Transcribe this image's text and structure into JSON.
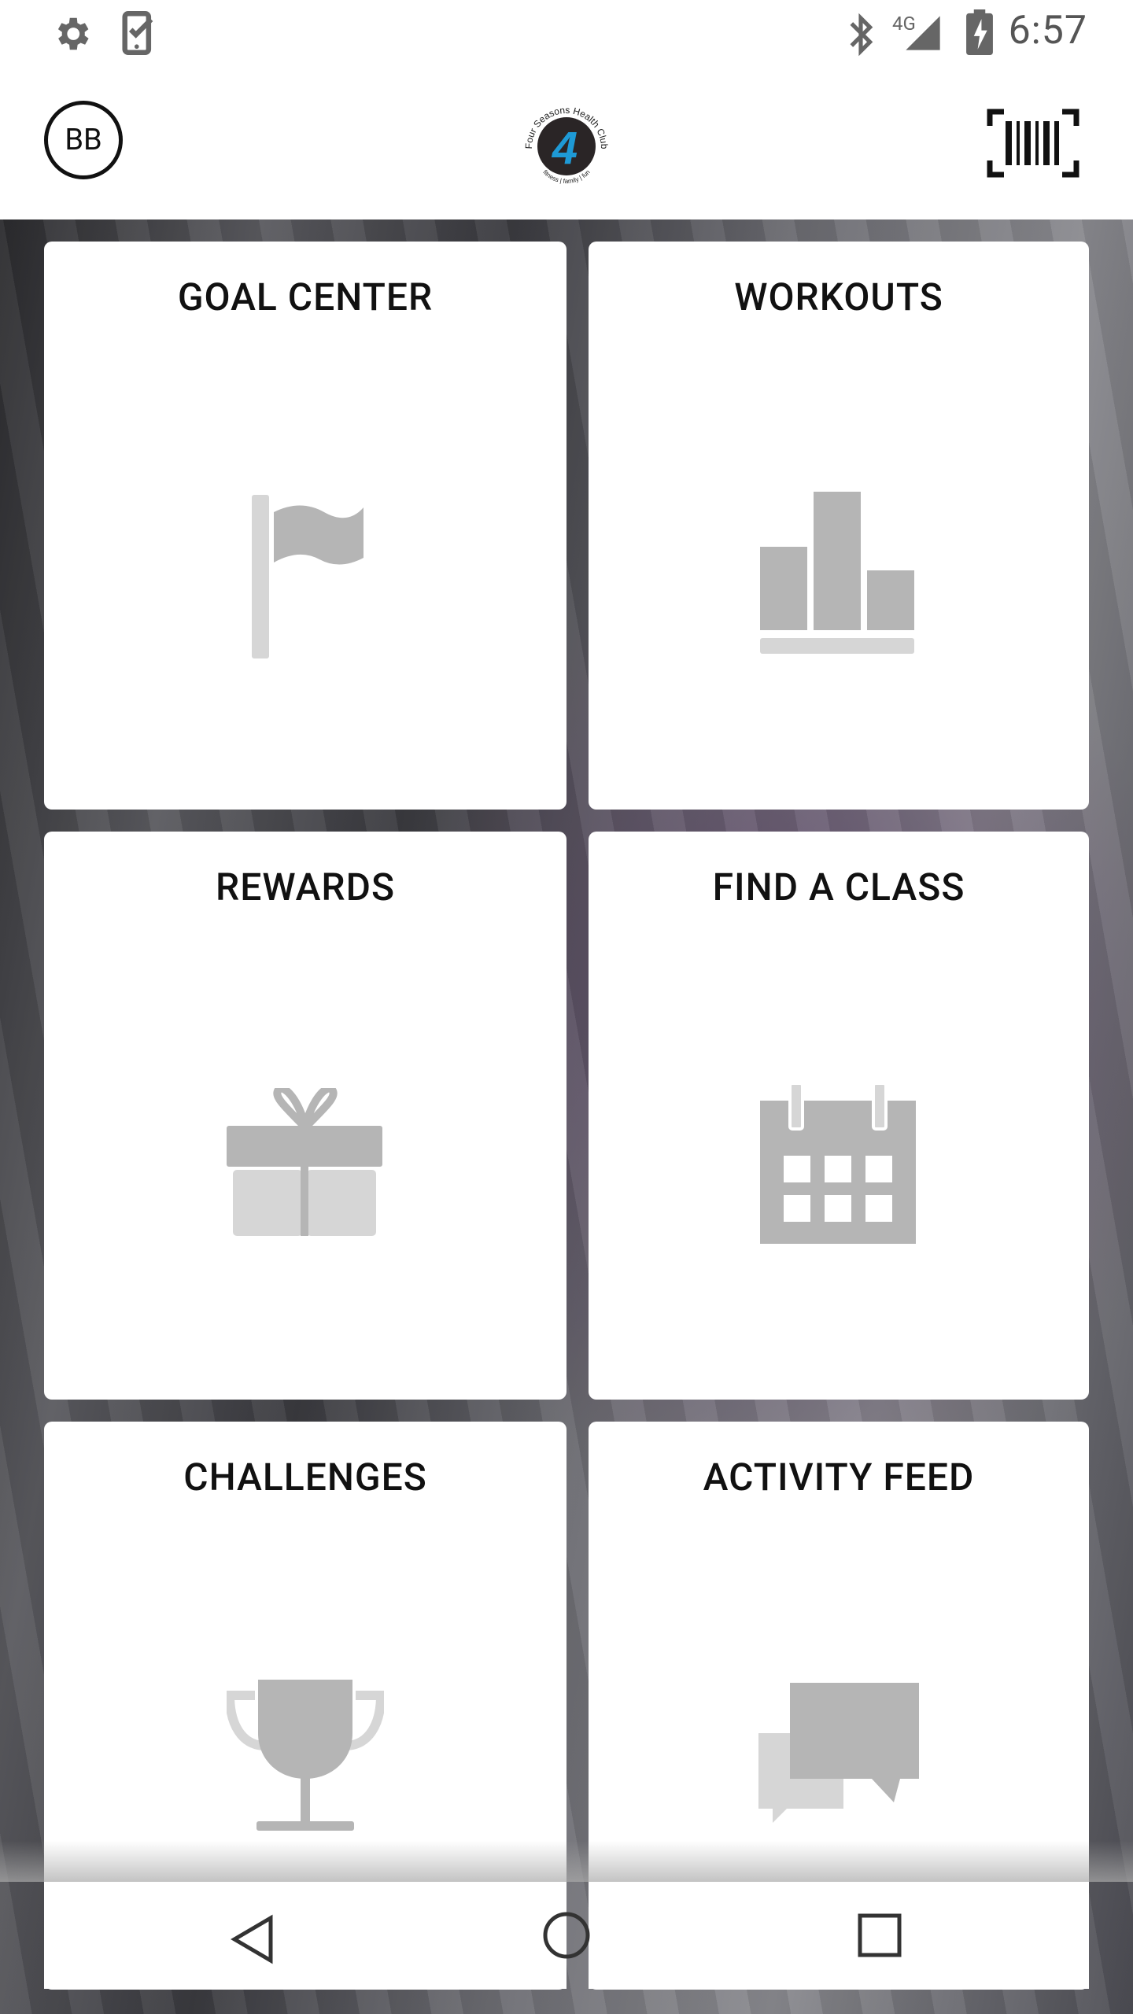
{
  "status_bar": {
    "time": "6:57",
    "network_label": "4G",
    "icons": [
      "settings-icon",
      "task-check-icon",
      "bluetooth-icon",
      "signal-icon",
      "battery-charging-icon"
    ]
  },
  "header": {
    "avatar_initials": "BB",
    "logo": {
      "top_text": "Four Seasons Health Club",
      "bottom_text": "fitness | family | fun",
      "mark": "4"
    },
    "barcode_icon": "barcode-scan-icon"
  },
  "tiles": [
    {
      "title": "GOAL CENTER",
      "icon": "flag-icon"
    },
    {
      "title": "WORKOUTS",
      "icon": "bar-chart-icon"
    },
    {
      "title": "REWARDS",
      "icon": "gift-icon"
    },
    {
      "title": "FIND A CLASS",
      "icon": "calendar-icon"
    },
    {
      "title": "CHALLENGES",
      "icon": "trophy-icon"
    },
    {
      "title": "ACTIVITY FEED",
      "icon": "chat-bubbles-icon"
    }
  ],
  "nav": {
    "icons": [
      "back-icon",
      "home-icon",
      "recents-icon"
    ]
  },
  "colors": {
    "icon_gray": "#b5b5b5",
    "icon_light_gray": "#d6d6d6",
    "logo_blue": "#1e9ad6"
  }
}
